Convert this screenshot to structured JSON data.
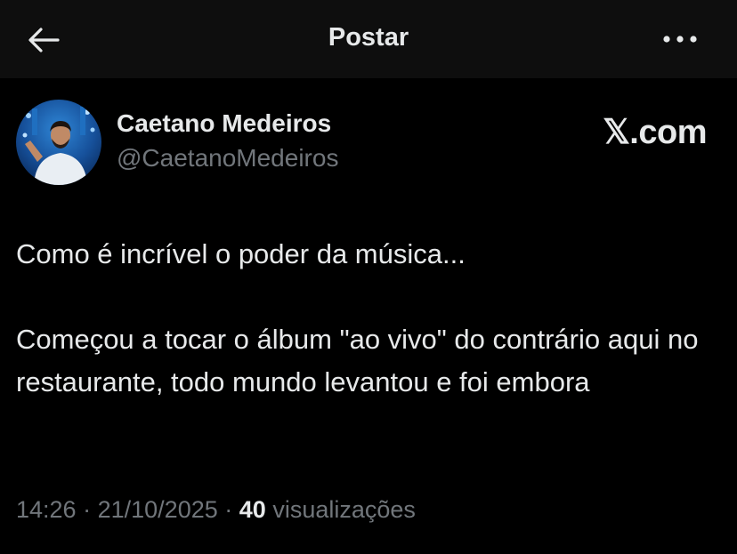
{
  "header": {
    "title": "Postar",
    "back_icon": "arrow-left-icon",
    "more_icon": "more-horizontal-icon"
  },
  "post": {
    "author": {
      "name": "Caetano Medeiros",
      "handle": "@CaetanoMedeiros",
      "avatar_icon": "user-avatar"
    },
    "source_label": "𝕏.com",
    "paragraphs": [
      "Como é incrível o poder da música...",
      "Começou a tocar o álbum \"ao vivo\" do contrário aqui no restaurante, todo mundo levantou e foi embora"
    ],
    "time": "14:26",
    "separator": "·",
    "date": "21/10/2025",
    "views_count": "40",
    "views_label": "visualizações"
  },
  "colors": {
    "background": "#000000",
    "header_background": "#0e0e0e",
    "primary_text": "#e7e9ea",
    "secondary_text": "#71767b"
  }
}
